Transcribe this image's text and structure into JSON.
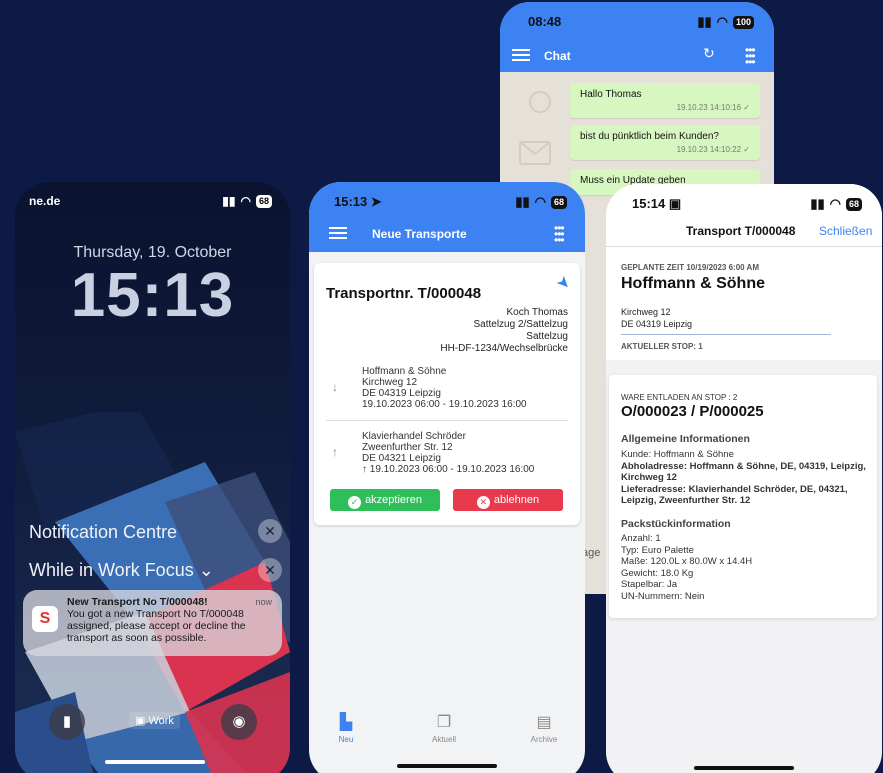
{
  "lockscreen": {
    "carrier": "ne.de",
    "battery": "68",
    "date": "Thursday, 19. October",
    "time": "15:13",
    "notification_centre": "Notification Centre",
    "focus_label": "While in Work Focus",
    "focus_chevron": "⌄",
    "notification": {
      "title": "New Transport No T/000048!",
      "time": "now",
      "body": "You got a new Transport No T/000048 assigned, please accept or decline the transport as soon as possible.",
      "app_icon": "S"
    },
    "work_label": "Work"
  },
  "transport": {
    "status_time": "15:13",
    "battery": "68",
    "header_title": "Neue Transporte",
    "number": "Transportnr. T/000048",
    "driver": [
      "Koch Thomas",
      "Sattelzug 2/Sattelzug",
      "Sattelzug",
      "HH-DF-1234/Wechselbrücke"
    ],
    "pickup": [
      "Hoffmann & Söhne",
      "Kirchweg 12",
      "DE 04319 Leipzig",
      "19.10.2023 06:00 - 19.10.2023 16:00"
    ],
    "delivery": [
      "Klavierhandel Schröder",
      "Zweenfurther Str. 12",
      "DE 04321 Leipzig",
      "19.10.2023 06:00 - 19.10.2023 16:00"
    ],
    "accept_label": "akzeptieren",
    "decline_label": "ablehnen",
    "tabs": [
      {
        "label": "Neu",
        "icon": "document-icon"
      },
      {
        "label": "Aktuell",
        "icon": "documents-icon"
      },
      {
        "label": "Archive",
        "icon": "archive-icon"
      }
    ],
    "colors": {
      "accent": "#3d82f3",
      "accept": "#2fbf5a",
      "decline": "#e8394d"
    }
  },
  "chat": {
    "status_time": "08:48",
    "battery": "100",
    "header_title": "Chat",
    "messages": [
      {
        "text": "Hallo Thomas",
        "time": "19.10.23 14:10:16 ✓"
      },
      {
        "text": "bist du pünktlich beim Kunden?",
        "time": "19.10.23 14:10:22 ✓"
      },
      {
        "text": "Muss ein Update geben",
        "time": ""
      }
    ],
    "partial_text": "age"
  },
  "detail": {
    "status_time": "15:14",
    "battery": "68",
    "header_title": "Transport T/000048",
    "close_label": "Schließen",
    "planned_time": "GEPLANTE ZEIT 10/19/2023 6:00 AM",
    "company": "Hoffmann & Söhne",
    "address_line1": "Kirchweg 12",
    "address_line2": "DE 04319 Leipzig",
    "current_stop": "AKTUELLER STOP: 1",
    "ware_label": "WARE ENTLADEN AN STOP : 2",
    "order_number": "O/000023 / P/000025",
    "general_title": "Allgemeine Informationen",
    "customer": "Kunde: Hoffmann & Söhne",
    "pickup_address": "Abholadresse: Hoffmann & Söhne, DE, 04319, Leipzig, Kirchweg 12",
    "delivery_address": "Lieferadresse: Klavierhandel Schröder, DE, 04321, Leipzig, Zweenfurther Str. 12",
    "package_title": "Packstückinformation",
    "package_lines": [
      "Anzahl: 1",
      "Typ: Euro Palette",
      "Maße: 120.0L x 80.0W x 14.4H",
      "Gewicht: 18.0 Kg",
      "Stapelbar: Ja",
      "UN-Nummern: Nein"
    ]
  }
}
